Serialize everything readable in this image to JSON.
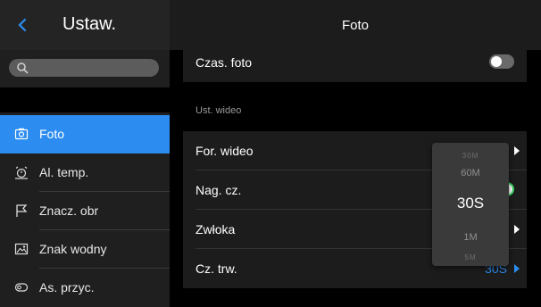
{
  "sidebar": {
    "title": "Ustaw.",
    "search_placeholder": "",
    "items": [
      {
        "label": "Foto",
        "icon": "camera-icon",
        "active": true
      },
      {
        "label": "Al. temp.",
        "icon": "alarm-icon",
        "active": false
      },
      {
        "label": "Znacz. obr",
        "icon": "flag-icon",
        "active": false
      },
      {
        "label": "Znak wodny",
        "icon": "watermark-icon",
        "active": false
      },
      {
        "label": "As. przyc.",
        "icon": "button-assist-icon",
        "active": false
      }
    ]
  },
  "main": {
    "title": "Foto",
    "rows": {
      "czas_foto": {
        "label": "Czas. foto",
        "toggle": "off"
      },
      "section": "Ust. wideo",
      "for_wideo": {
        "label": "For. wideo"
      },
      "nag_cz": {
        "label": "Nag. cz.",
        "toggle": "on"
      },
      "zwloka": {
        "label": "Zwłoka"
      },
      "cz_trw": {
        "label": "Cz. trw.",
        "value": "30S"
      }
    }
  },
  "picker": {
    "options": [
      "30M",
      "60M",
      "30S",
      "1M",
      "5M"
    ],
    "selected": "30S"
  },
  "colors": {
    "accent": "#2c8cf0",
    "toggle_on": "#33d15b",
    "background": "#000000",
    "panel": "#1c1c1c"
  }
}
